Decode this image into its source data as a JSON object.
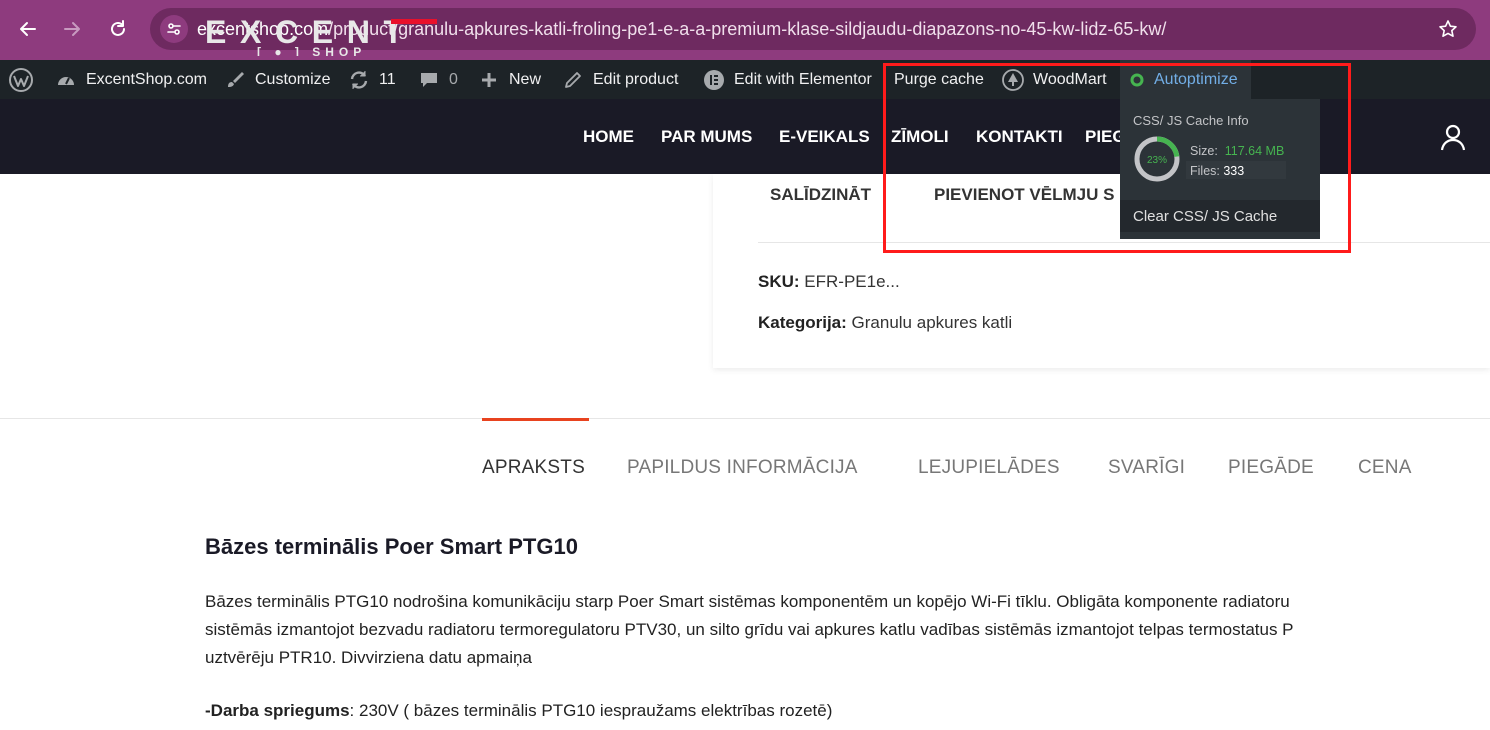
{
  "browser": {
    "url_host": "excentshop.com",
    "url_path": "/product/granulu-apkures-katli-froling-pe1-e-a-a-premium-klase-sildjaudu-diapazons-no-45-kw-lidz-65-kw/"
  },
  "admin_bar": {
    "site_name": "ExcentShop.com",
    "customize": "Customize",
    "updates_count": "11",
    "comments_count": "0",
    "new": "New",
    "edit_product": "Edit product",
    "edit_elementor": "Edit with Elementor",
    "purge_cache": "Purge cache",
    "woodmart": "WoodMart",
    "autoptimize": "Autoptimize"
  },
  "autoptimize_menu": {
    "cache_info_title": "CSS/ JS Cache Info",
    "gauge_percent": "23%",
    "gauge_fraction": 0.23,
    "size_label": "Size:",
    "size_value": "117.64 MB",
    "files_label": "Files:",
    "files_value": "333",
    "clear_label": "Clear CSS/ JS Cache",
    "status_color": "#46b450"
  },
  "header": {
    "logo_text": "EXCENT",
    "logo_sub": "[ ● ] SHOP",
    "nav": [
      "HOME",
      "PAR MUMS",
      "E-VEIKALS",
      "ZĪMOLI",
      "KONTAKTI",
      "PIEG"
    ]
  },
  "product": {
    "compare": "SALĪDZINĀT",
    "wishlist": "PIEVIENOT VĒLMJU S",
    "sku_label": "SKU:",
    "sku_value": "EFR-PE1e...",
    "category_label": "Kategorija:",
    "category_value": "Granulu apkures katli"
  },
  "tabs": [
    "APRAKSTS",
    "PAPILDUS INFORMĀCIJA",
    "LEJUPIELĀDES",
    "SVARĪGI",
    "PIEGĀDE",
    "CENA"
  ],
  "content": {
    "heading": "Bāzes terminālis Poer Smart PTG10",
    "para_line1": "Bāzes terminālis PTG10 nodrošina komunikāciju starp Poer Smart sistēmas komponentēm un kopējo Wi-Fi tīklu. Obligāta komponente radiatoru",
    "para_line2": "sistēmās izmantojot bezvadu radiatoru termoregulatoru PTV30, un silto grīdu vai apkures katlu vadības sistēmās izmantojot telpas termostatus P",
    "para_line3": "uztvērēju PTR10. Divvirziena datu apmaiņa",
    "voltage_label": "-Darba spriegums",
    "voltage_value": ": 230V ( bāzes terminālis PTG10 iespraužams elektrības rozetē)"
  },
  "colors": {
    "browser_bar": "#8e3b7e",
    "admin_bar": "#1d2327",
    "site_header": "#1a1a26",
    "accent": "#e8431f",
    "highlight": "#ff1b1b"
  }
}
